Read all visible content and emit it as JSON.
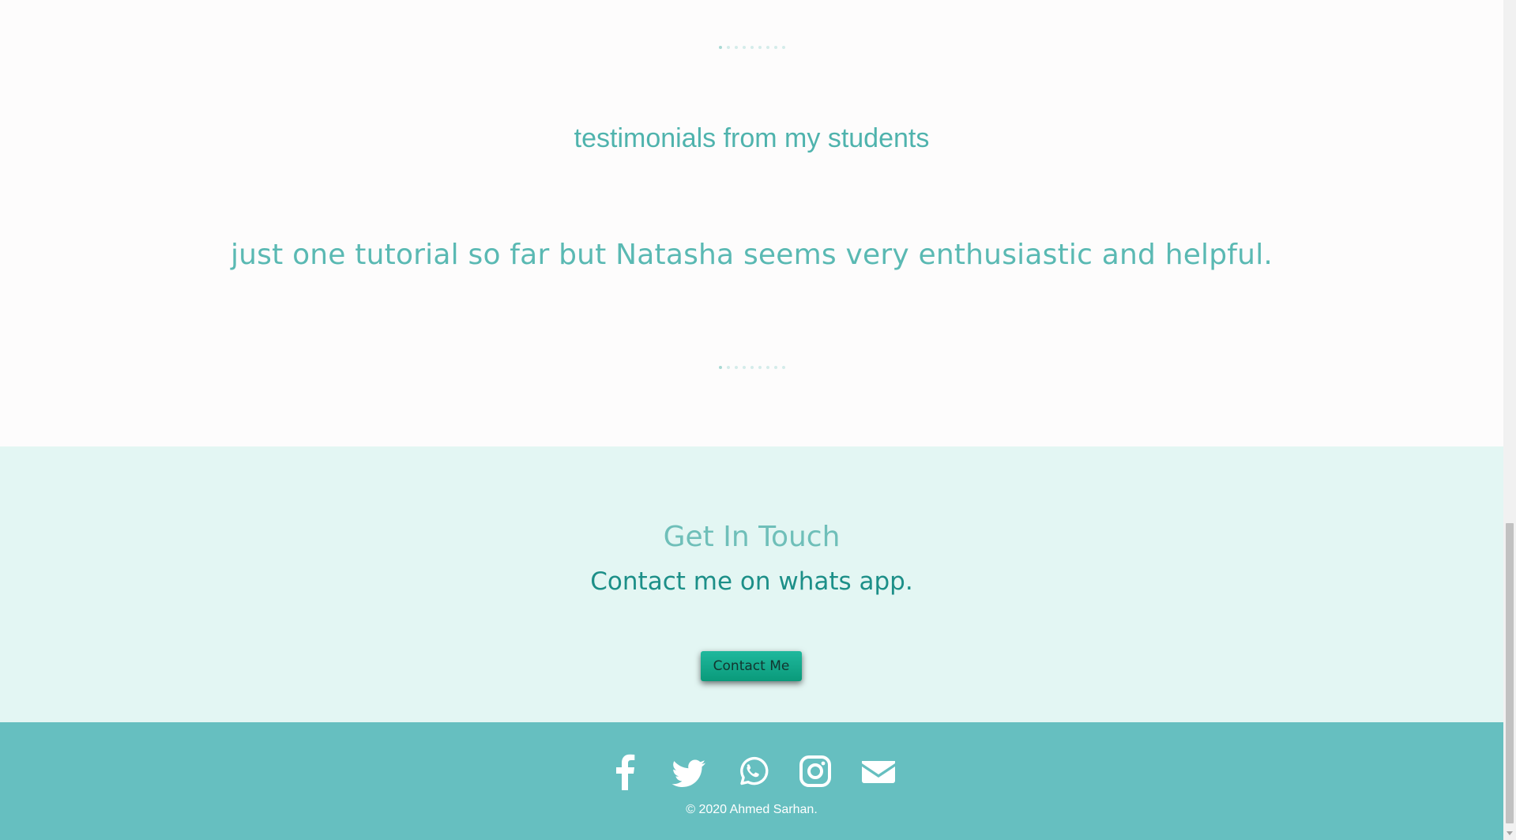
{
  "testimonials": {
    "heading": "testimonials from my students",
    "quote": "just one tutorial so far but Natasha seems very enthusiastic and helpful."
  },
  "contact": {
    "heading": "Get In Touch",
    "subheading": "Contact me on whats app.",
    "button_label": "Contact Me"
  },
  "footer": {
    "social_icons": [
      "facebook-icon",
      "twitter-icon",
      "whatsapp-icon",
      "instagram-icon",
      "envelope-icon"
    ],
    "copyright": "© 2020 Ahmed Sarhan."
  },
  "colors": {
    "accent": "#4fb3ad",
    "contact_bg": "#e3f6f3",
    "footer_bg": "#66bfc0",
    "button": "#0fa98a"
  }
}
